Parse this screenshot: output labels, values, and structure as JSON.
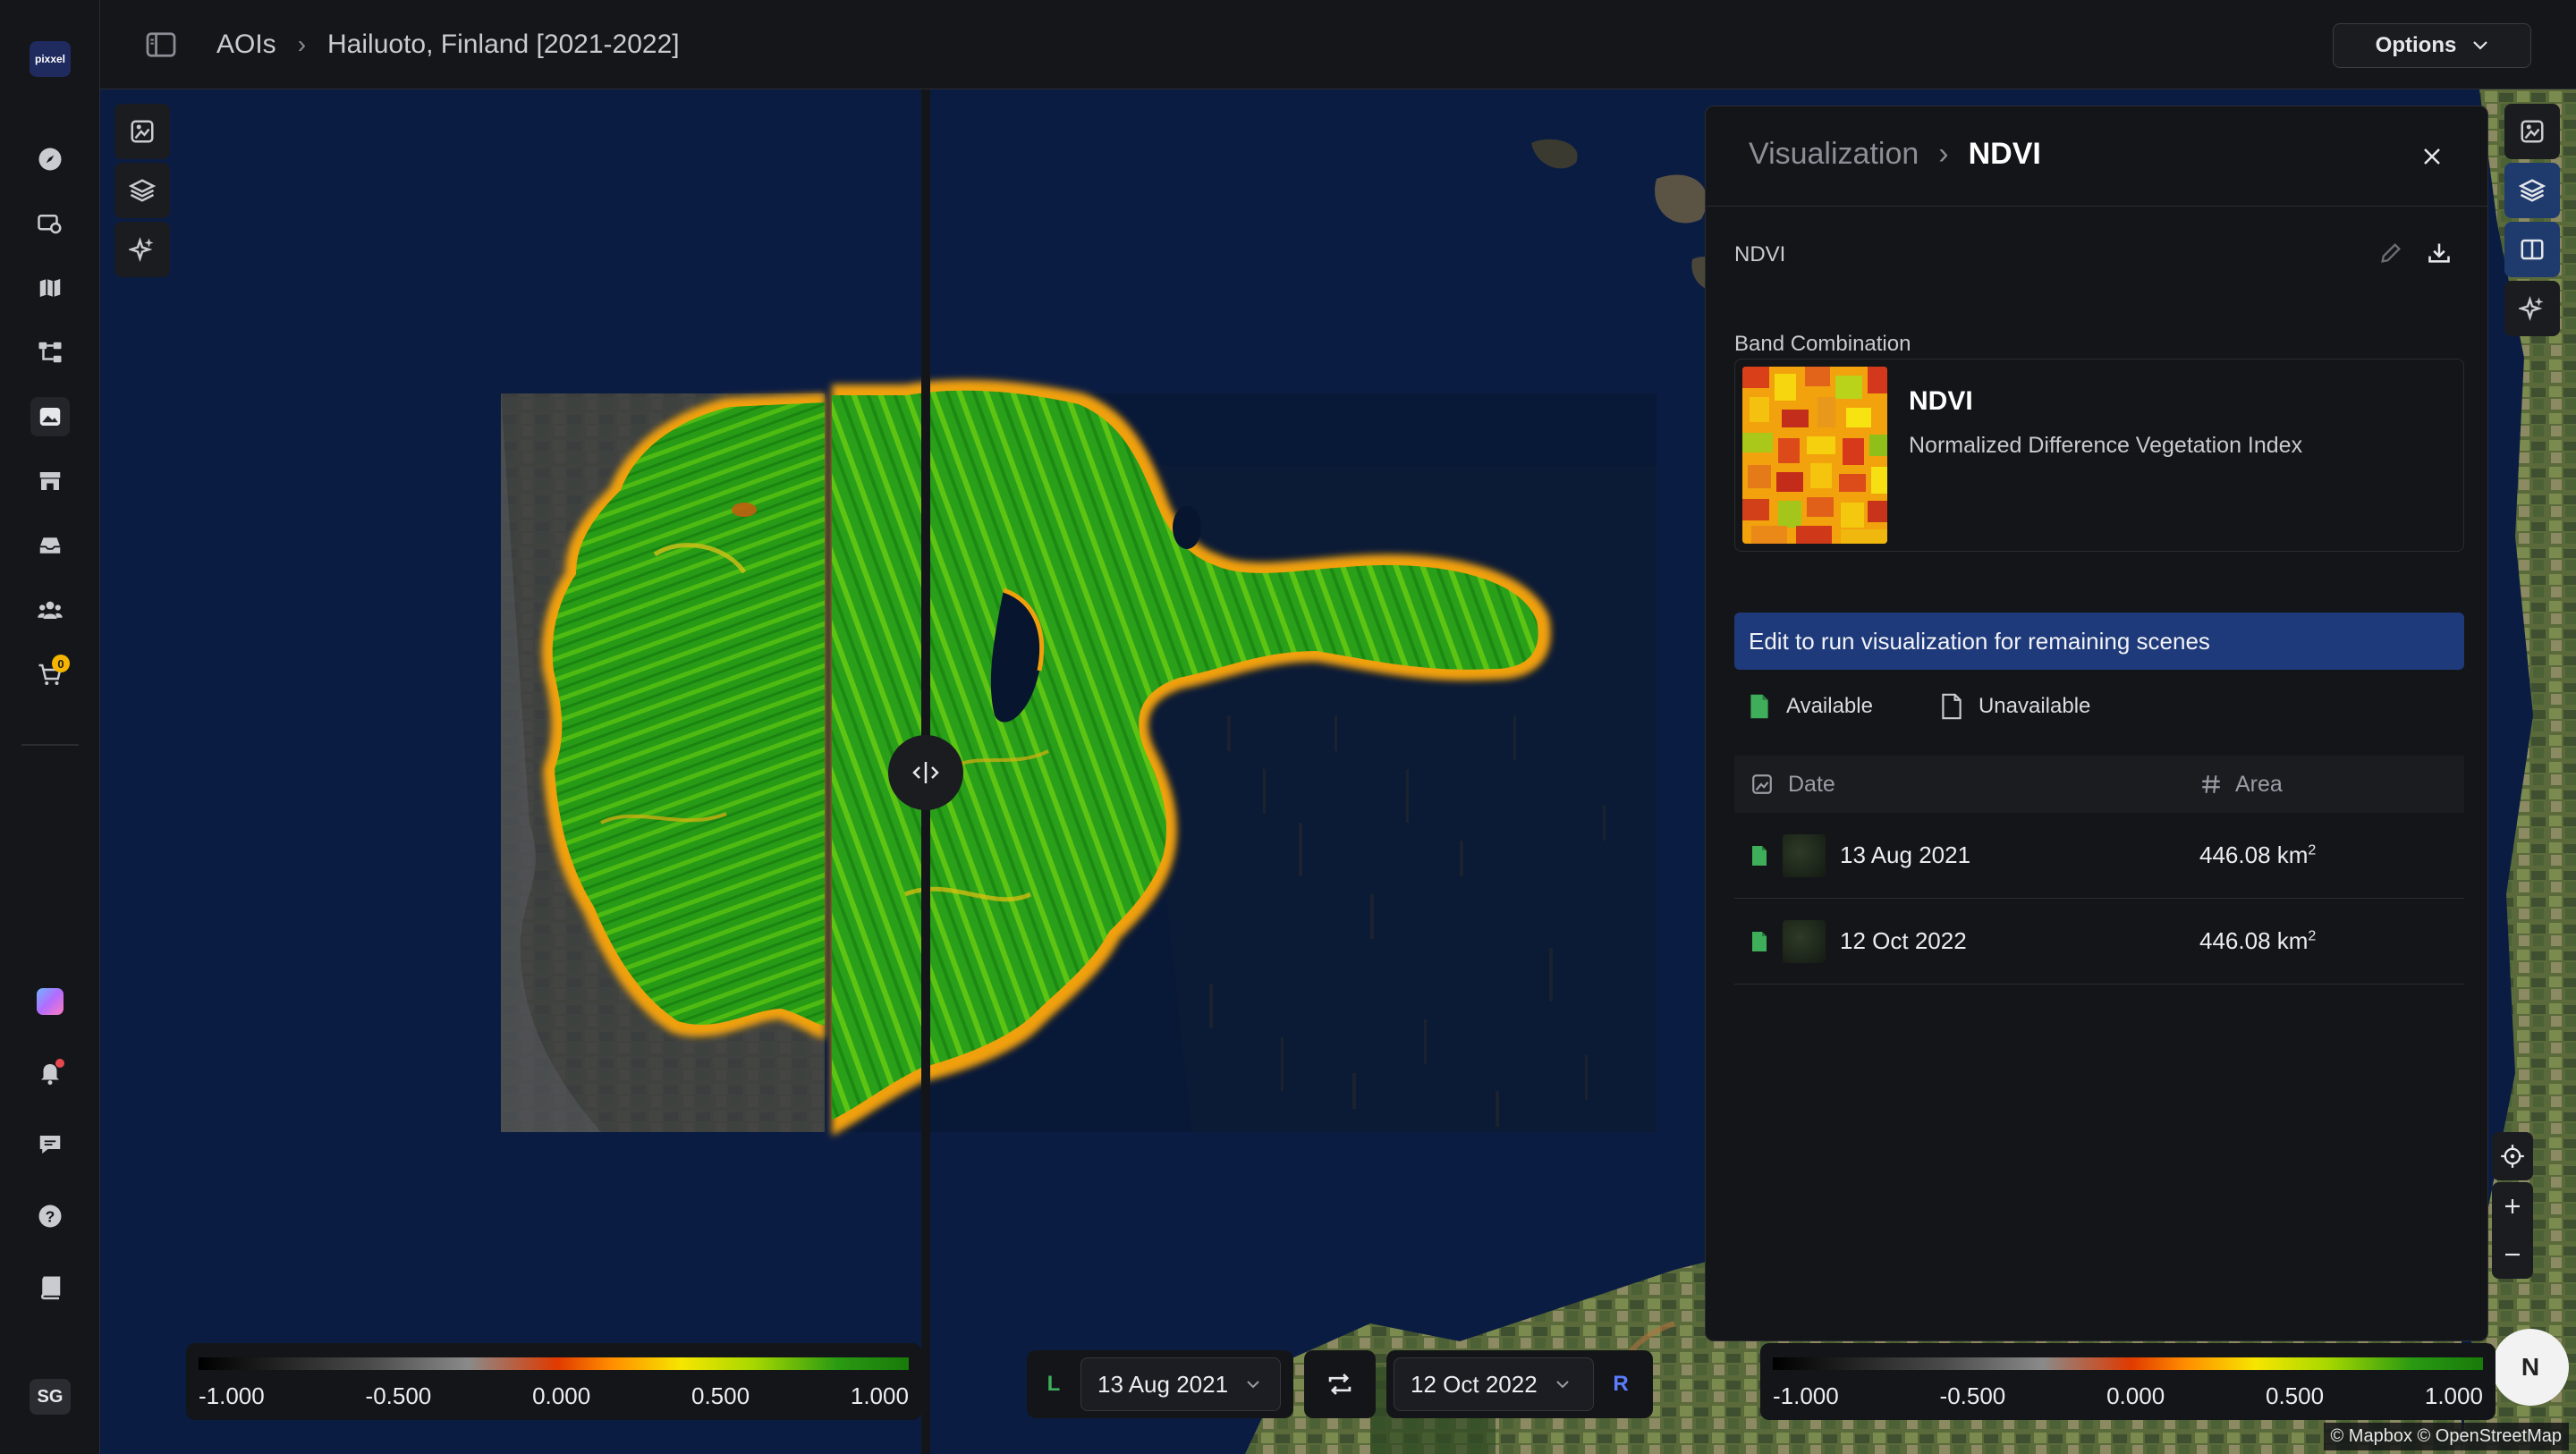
{
  "app": {
    "logo_text": "pixxel",
    "user_initials": "SG",
    "cart_count": "0"
  },
  "breadcrumb": {
    "root": "AOIs",
    "current": "Hailuoto, Finland [2021-2022]"
  },
  "options": {
    "label": "Options"
  },
  "panel": {
    "crumb_parent": "Visualization",
    "crumb_current": "NDVI",
    "viz_name": "NDVI",
    "band_section_label": "Band Combination",
    "band_name": "NDVI",
    "band_description": "Normalized Difference Vegetation Index",
    "notice": "Edit to run visualization for remaining scenes",
    "available_label": "Available",
    "unavailable_label": "Unavailable",
    "table": {
      "col_date": "Date",
      "col_area": "Area",
      "rows": [
        {
          "date": "13 Aug 2021",
          "area": "446.08 km",
          "unit_sup": "2"
        },
        {
          "date": "12 Oct 2022",
          "area": "446.08 km",
          "unit_sup": "2"
        }
      ]
    }
  },
  "compare": {
    "left_tag": "L",
    "right_tag": "R",
    "left_date": "13 Aug 2021",
    "right_date": "12 Oct 2022"
  },
  "legend": {
    "ticks": [
      "-1.000",
      "-0.500",
      "0.000",
      "0.500",
      "1.000"
    ]
  },
  "map": {
    "attribution": "© Mapbox © OpenStreetMap",
    "compass": "N"
  },
  "colors": {
    "accent": "#1f3a7a",
    "available_green": "#3fae5b",
    "left_tag": "#3fae5b",
    "right_tag": "#5b7cff"
  }
}
